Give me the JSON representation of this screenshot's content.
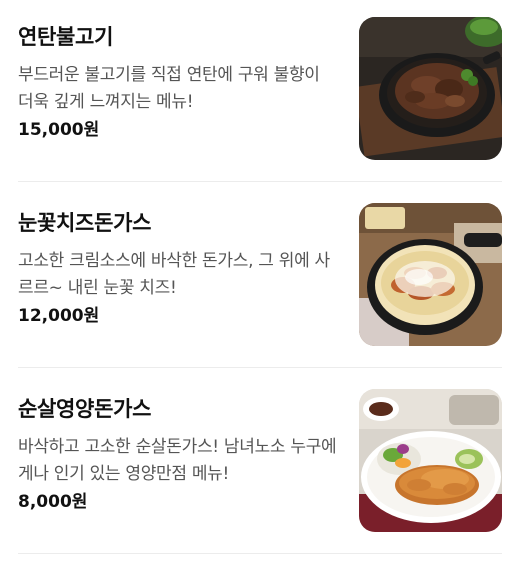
{
  "menu": {
    "items": [
      {
        "name": "연탄불고기",
        "description": "부드러운 불고기를 직접 연탄에 구워 불향이 더욱 깊게 느껴지는 메뉴!",
        "price": "15,000원",
        "image_icon": "bulgogi-dish-image"
      },
      {
        "name": "눈꽃치즈돈가스",
        "description": "고소한 크림소스에 바삭한 돈가스, 그 위에 사르르~ 내린 눈꽃 치즈!",
        "price": "12,000원",
        "image_icon": "cheese-tonkatsu-dish-image"
      },
      {
        "name": "순살영양돈가스",
        "description": "바삭하고 고소한 순살돈가스! 남녀노소 누구에게나 인기 있는 영양만점 메뉴!",
        "price": "8,000원",
        "image_icon": "tonkatsu-plate-dish-image"
      }
    ]
  },
  "colors": {
    "text_primary": "#111111",
    "text_secondary": "#555555",
    "divider": "#ececec"
  }
}
